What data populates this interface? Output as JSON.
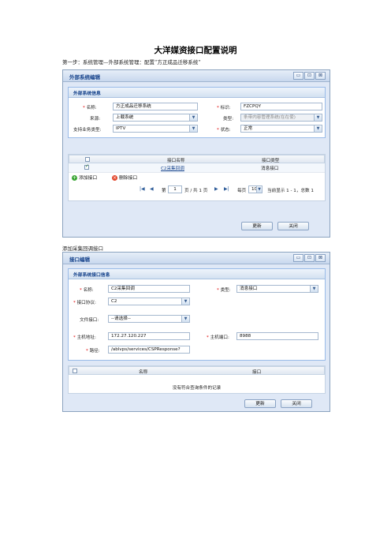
{
  "doc": {
    "title": "大洋媒资接口配置说明",
    "step1": "第一步：系统管理—外部系统管理：配置“方正成品迁移系统”",
    "step2": "添加采集回调接口"
  },
  "window1": {
    "title": "外部系统编辑",
    "controls": [
      "▭",
      "⊡",
      "⊠"
    ],
    "panel_title": "外部系统信息",
    "form": {
      "name_label": "名称:",
      "name_value": "方正成品迁移系统",
      "code_label": "标识:",
      "code_value": "FZCPQY",
      "source_label": "来源:",
      "source_value": "上载系统",
      "type_label": "类型:",
      "type_value": "条带内容管理系统(在在使)",
      "biz_label": "支持业务类型:",
      "biz_value": "IPTV",
      "status_label": "状态:",
      "status_value": "正常"
    },
    "grid": {
      "columns": [
        "接口名称",
        "接口类型"
      ],
      "rows": [
        {
          "name": "C2采集回调",
          "type": "消息接口",
          "checked": true
        }
      ]
    },
    "toolbar": {
      "add": "添加接口",
      "delete": "删除接口"
    },
    "pager": {
      "page_prefix": "第",
      "page_value": "1",
      "page_suffix": "页 / 共 1 页",
      "per_page_prefix": "每页",
      "per_page_value": "10",
      "summary": "当前显示 1 - 1，总数 1"
    },
    "buttons": {
      "update": "更新",
      "close": "关闭"
    }
  },
  "window2": {
    "title": "接口编辑",
    "controls": [
      "▭",
      "⊡",
      "⊠"
    ],
    "panel_title": "外部系统接口信息",
    "form": {
      "name_label": "名称:",
      "name_value": "C2采集回调",
      "type_label": "类型:",
      "type_value": "消息接口",
      "protocol_label": "接口协议:",
      "protocol_value": "C2",
      "file_label": "文件接口:",
      "file_value": "--请选择--",
      "host_label": "主机地址:",
      "host_value": "172.27.120.227",
      "port_label": "主机端口:",
      "port_value": "8988",
      "path_label": "路径:",
      "path_value": "/ablvps/services/CSPResponse?"
    },
    "grid": {
      "columns": [
        "名称",
        "接口"
      ],
      "empty_text": "没有符合查询条件的记录"
    },
    "buttons": {
      "update": "更新",
      "close": "关闭"
    }
  },
  "colors": {
    "window_bg": "#dfe8f6",
    "title_text": "#15428b",
    "required": "#e00000"
  }
}
